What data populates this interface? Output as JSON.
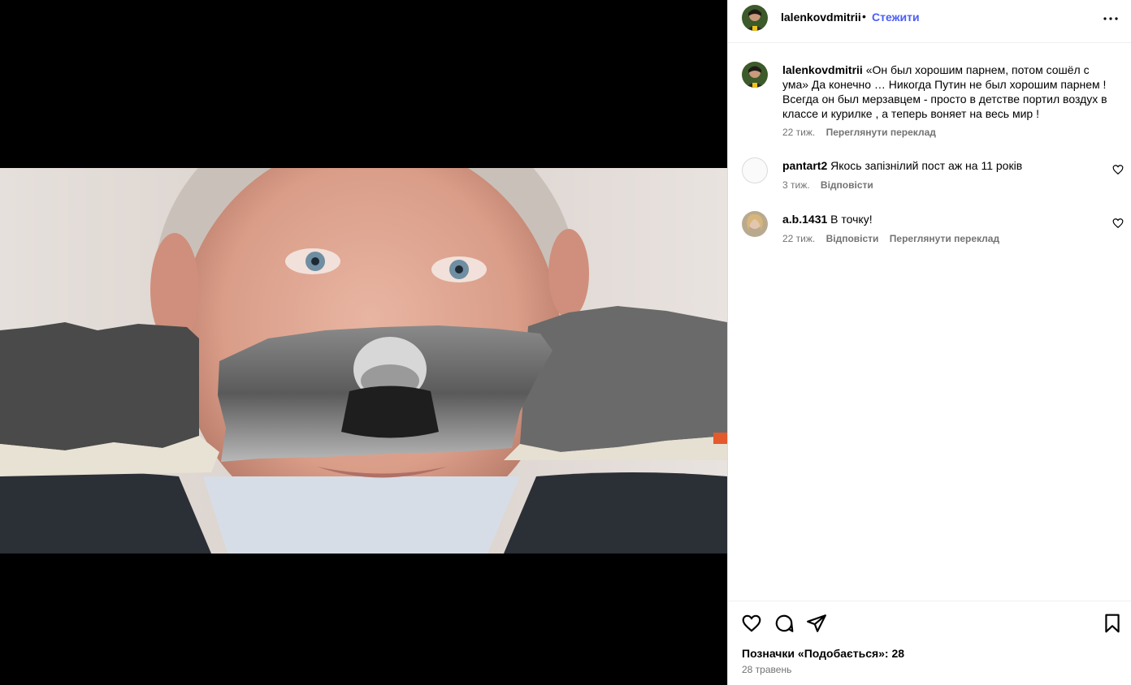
{
  "post": {
    "author": "lalenkovdmitrii",
    "follow_label": "Стежити",
    "separator": "•"
  },
  "caption": {
    "user": "lalenkovdmitrii",
    "text": "«Он был хорошим парнем, потом сошёл с ума» Да конечно … Никогда Путин не был хорошим парнем ! Всегда он был мерзавцем - просто в детстве портил воздух в классе и курилке , а теперь воняет на весь мир !",
    "time": "22 тиж.",
    "translate": "Переглянути переклад"
  },
  "comments": [
    {
      "user": "pantart2",
      "text": "Якось запізнілий пост аж на 11 років",
      "time": "3 тиж.",
      "reply": "Відповісти",
      "translate": ""
    },
    {
      "user": "a.b.1431",
      "text": "В точку!",
      "time": "22 тиж.",
      "reply": "Відповісти",
      "translate": "Переглянути переклад"
    }
  ],
  "footer": {
    "likes": "Позначки «Подобається»: 28",
    "date": "28 травень"
  },
  "icons": {
    "more": "more-options-icon",
    "like": "heart-icon",
    "comment": "comment-icon",
    "share": "share-icon",
    "save": "bookmark-icon"
  },
  "colors": {
    "follow": "#4a5df9",
    "meta": "#737373"
  }
}
